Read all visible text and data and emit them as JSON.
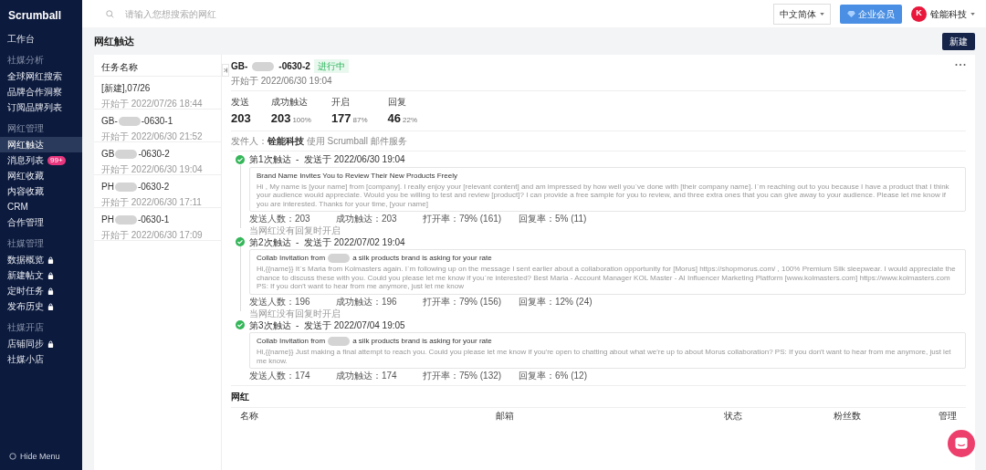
{
  "brand": "Scrumball",
  "sidebar": {
    "items": [
      {
        "kind": "item",
        "label": "工作台",
        "selected": false
      },
      {
        "kind": "section",
        "label": "社媒分析"
      },
      {
        "kind": "item",
        "label": "全球网红搜索",
        "selected": false
      },
      {
        "kind": "item",
        "label": "品牌合作洞察",
        "selected": false
      },
      {
        "kind": "item",
        "label": "订阅品牌列表",
        "selected": false
      },
      {
        "kind": "section",
        "label": "网红管理"
      },
      {
        "kind": "item",
        "label": "网红触达",
        "selected": true
      },
      {
        "kind": "item",
        "label": "消息列表",
        "selected": false,
        "badge": "99+"
      },
      {
        "kind": "item",
        "label": "网红收藏",
        "selected": false
      },
      {
        "kind": "item",
        "label": "内容收藏",
        "selected": false
      },
      {
        "kind": "item",
        "label": "CRM",
        "selected": false
      },
      {
        "kind": "item",
        "label": "合作管理",
        "selected": false
      },
      {
        "kind": "section",
        "label": "社媒管理"
      },
      {
        "kind": "item",
        "label": "数据概览",
        "selected": false,
        "locked": true
      },
      {
        "kind": "item",
        "label": "新建帖文",
        "selected": false,
        "locked": true
      },
      {
        "kind": "item",
        "label": "定时任务",
        "selected": false,
        "locked": true
      },
      {
        "kind": "item",
        "label": "发布历史",
        "selected": false,
        "locked": true
      },
      {
        "kind": "section",
        "label": "社媒开店"
      },
      {
        "kind": "item",
        "label": "店铺同步",
        "selected": false,
        "locked": true
      },
      {
        "kind": "item",
        "label": "社媒小店",
        "selected": false
      }
    ],
    "hide_menu": "Hide Menu"
  },
  "topbar": {
    "search": {
      "placeholder": "请输入您想搜索的网红"
    },
    "language": "中文简体",
    "vip_button": "企业会员",
    "avatar_text": "K",
    "account": "铨能科技"
  },
  "page": {
    "title": "网红触达",
    "new_button": "新建"
  },
  "tasks": {
    "header": "任务名称",
    "items": [
      {
        "prefix": "[新建],07/26",
        "redacted": false,
        "start": "开始于 2022/07/26 18:44"
      },
      {
        "prefix": "GB-",
        "redacted": true,
        "suffix": "-0630-1",
        "start": "开始于 2022/06/30 21:52"
      },
      {
        "prefix": "GB",
        "redacted": true,
        "suffix": "-0630-2",
        "start": "开始于 2022/06/30 19:04"
      },
      {
        "prefix": "PH",
        "redacted": true,
        "suffix": "-0630-2",
        "start": "开始于 2022/06/30 17:11"
      },
      {
        "prefix": "PH",
        "redacted": true,
        "suffix": "-0630-1",
        "start": "开始于 2022/06/30 17:09"
      }
    ]
  },
  "detail": {
    "prefix": "GB-",
    "redacted": true,
    "suffix": "-0630-2",
    "status": "进行中",
    "start": "开始于 2022/06/30 19:04",
    "stats": [
      {
        "label": "发送",
        "value": "203"
      },
      {
        "label": "成功触达",
        "value": "203",
        "pct": "100%"
      },
      {
        "label": "开启",
        "value": "177",
        "pct": "87%"
      },
      {
        "label": "回复",
        "value": "46",
        "pct": "22%"
      }
    ],
    "sender_label": "发件人：",
    "sender": "铨能科技",
    "sender_note": "使用 Scrumball 邮件服务",
    "steps": [
      {
        "title": "第1次触达  -  发送于 2022/06/30 19:04",
        "subject_prefix": "Brand Name Invites You to Review Their New Products Freely",
        "redacted": false,
        "body": "Hi , My name is [your name] from [company]. I really enjoy your [relevant content] and am impressed by how well you`ve done with [their company name]. I`m reaching out to you because I have a product that I think your audience would appreciate. Would you be willing to test and review [product]? I can provide a free sample for you to review, and three extra ones that you can give away to your audience. Please let me know if you are interested. Thanks for your time, [your name]",
        "stats": [
          "发送人数：203",
          "成功触达：203",
          "打开率：79% (161)",
          "回复率：5% (11)"
        ]
      },
      {
        "condition": "当网红没有回复时开启",
        "title": "第2次触达  -  发送于 2022/07/02 19:04",
        "subject_prefix": "Collab Invitation from",
        "redacted": true,
        "subject_suffix": "a silk products brand is asking for your rate",
        "body": "Hi,{{name}} It`s Maria from Kolmasters again. I`m following up on the message I sent earlier about a collaboration opportunity for [Morus] https://shopmorus.com/ , 100% Premium Silk sleepwear. I would appreciate the chance to discuss these with you. Could you please let me know if you`re interested? Best Maria - Account Manager KOL Master - AI Influencer Marketing Platform [www.kolmasters.com] https://www.kolmasters.com PS: If you don't want to hear from me anymore, just let me know",
        "stats": [
          "发送人数：196",
          "成功触达：196",
          "打开率：79% (156)",
          "回复率：12% (24)"
        ]
      },
      {
        "condition": "当网红没有回复时开启",
        "title": "第3次触达  -  发送于 2022/07/04 19:05",
        "subject_prefix": "Collab Invitation from",
        "redacted": true,
        "subject_suffix": "a silk products brand is asking for your rate",
        "body": "Hi,{{name}} Just making a final attempt to reach you. Could you please let me know if you're open to chatting about what we're up to about Morus collaboration? PS: If you don't want to hear from me anymore, just let me know.",
        "stats": [
          "发送人数：174",
          "成功触达：174",
          "打开率：75% (132)",
          "回复率：6% (12)"
        ]
      }
    ]
  },
  "influencers": {
    "title": "网红",
    "columns": [
      "名称",
      "邮箱",
      "状态",
      "粉丝数",
      "管理"
    ]
  }
}
